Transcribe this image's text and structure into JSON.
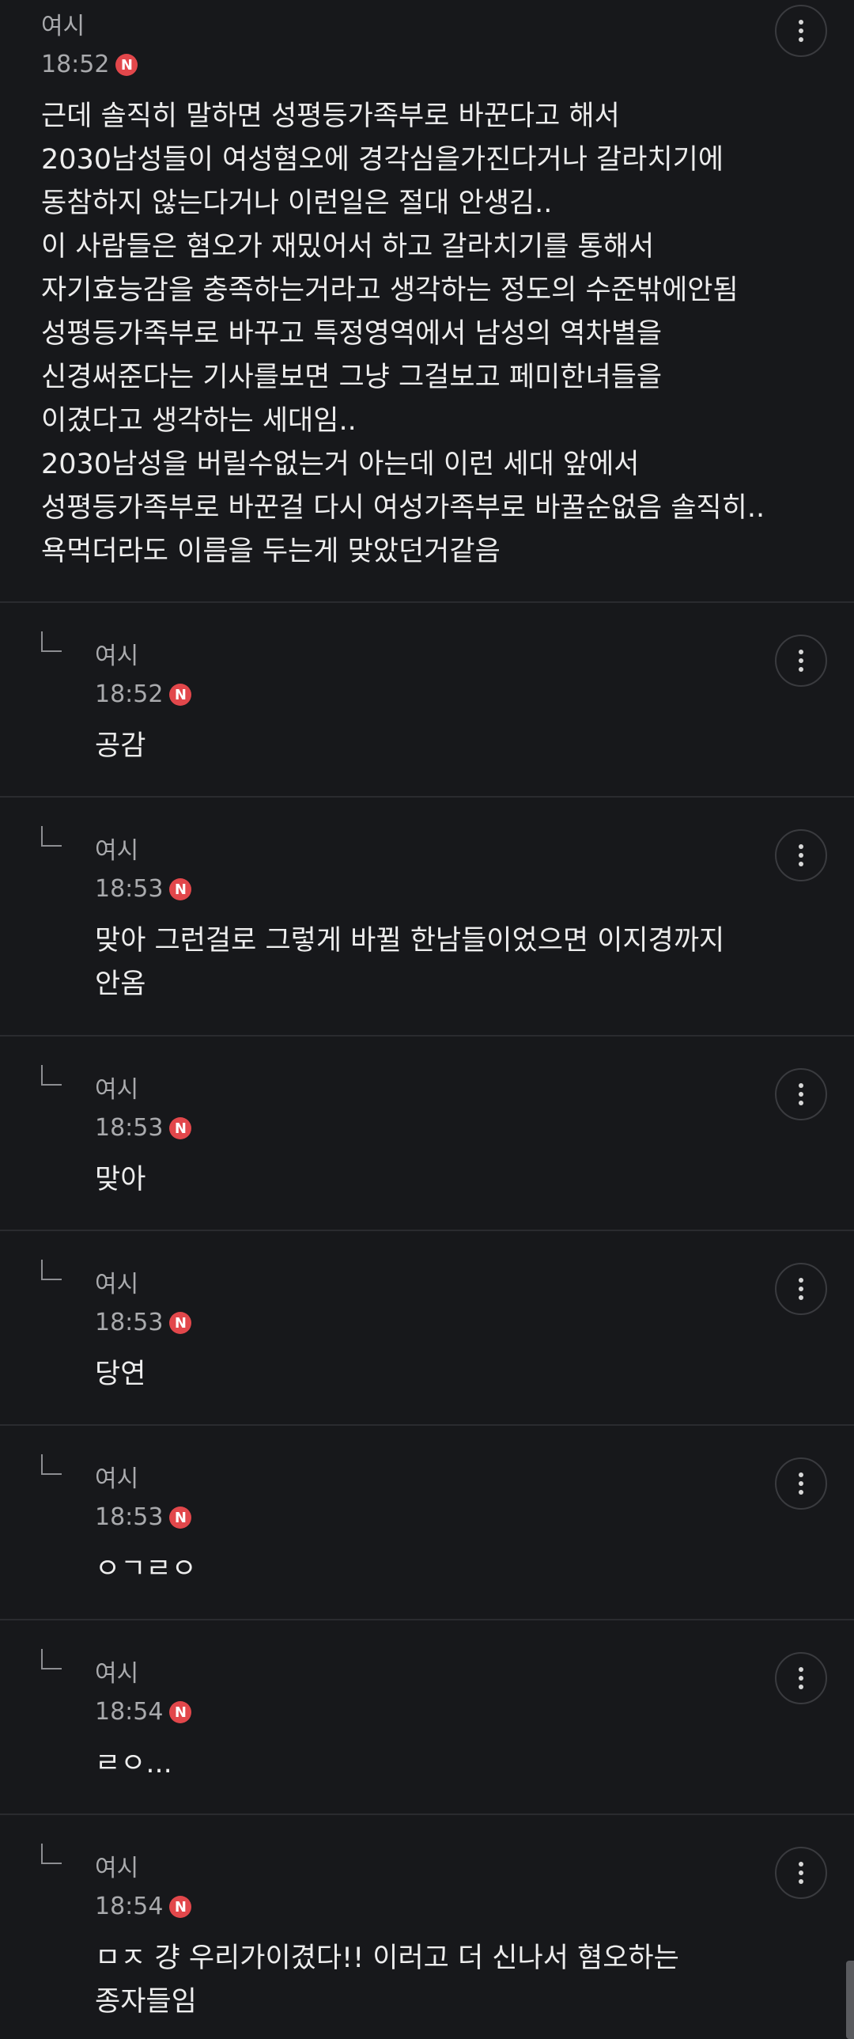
{
  "comments": [
    {
      "author": "여시",
      "time": "18:52",
      "badge": "N",
      "text": "근데 솔직히 말하면 성평등가족부로 바꾼다고 해서\n2030남성들이 여성혐오에 경각심을가진다거나 갈라치기에\n동참하지 않는다거나 이런일은 절대 안생김..\n이 사람들은 혐오가 재밌어서 하고 갈라치기를 통해서\n자기효능감을 충족하는거라고 생각하는 정도의 수준밖에안됨\n성평등가족부로 바꾸고 특정영역에서 남성의 역차별을\n신경써준다는 기사를보면 그냥 그걸보고 페미한녀들을\n이겼다고 생각하는 세대임..\n2030남성을 버릴수없는거 아는데 이런 세대 앞에서\n성평등가족부로 바꾼걸 다시 여성가족부로 바꿀순없음 솔직히..\n욕먹더라도 이름을 두는게 맞았던거같음"
    },
    {
      "author": "여시",
      "time": "18:52",
      "badge": "N",
      "text": "공감"
    },
    {
      "author": "여시",
      "time": "18:53",
      "badge": "N",
      "text": "맞아 그런걸로 그렇게 바뀔 한남들이었으면 이지경까지\n안옴"
    },
    {
      "author": "여시",
      "time": "18:53",
      "badge": "N",
      "text": "맞아"
    },
    {
      "author": "여시",
      "time": "18:53",
      "badge": "N",
      "text": "당연"
    },
    {
      "author": "여시",
      "time": "18:53",
      "badge": "N",
      "text": "ㅇㄱㄹㅇ"
    },
    {
      "author": "여시",
      "time": "18:54",
      "badge": "N",
      "text": "ㄹㅇ..."
    },
    {
      "author": "여시",
      "time": "18:54",
      "badge": "N",
      "text": "ㅁㅈ 걍 우리가이겼다!! 이러고 더 신나서 혐오하는\n종자들임"
    }
  ],
  "colors": {
    "background": "#17181b",
    "divider": "#2a2b2f",
    "badge": "#e2474b",
    "meta_text": "#a9aaad",
    "body_text": "#ededed"
  },
  "icons": {
    "menu": "more-vertical-icon",
    "reply": "reply-arrow-icon",
    "new": "new-badge-icon"
  }
}
